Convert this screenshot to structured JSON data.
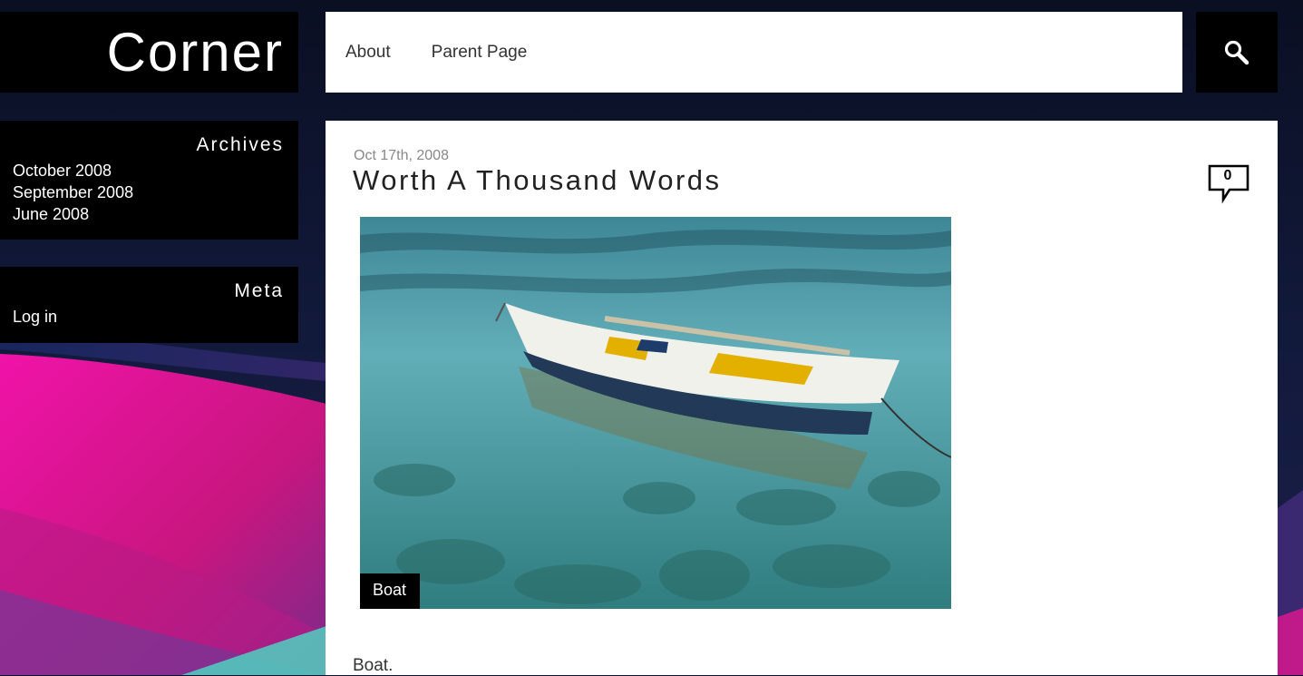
{
  "site": {
    "title": "Corner"
  },
  "nav": {
    "items": [
      {
        "label": "About"
      },
      {
        "label": "Parent Page"
      }
    ]
  },
  "search": {
    "icon": "search-icon"
  },
  "widgets": {
    "archives": {
      "title": "Archives",
      "items": [
        {
          "label": "October 2008"
        },
        {
          "label": "September 2008"
        },
        {
          "label": "June 2008"
        }
      ]
    },
    "meta": {
      "title": "Meta",
      "items": [
        {
          "label": "Log in"
        }
      ]
    }
  },
  "post": {
    "date": "Oct 17th, 2008",
    "title": "Worth A Thousand Words",
    "comment_count": "0",
    "image_caption": "Boat",
    "body": "Boat."
  },
  "colors": {
    "panel_dark": "#000000",
    "panel_light": "#ffffff",
    "background_navy": "#0b1330",
    "accent_magenta": "#e0149a"
  }
}
